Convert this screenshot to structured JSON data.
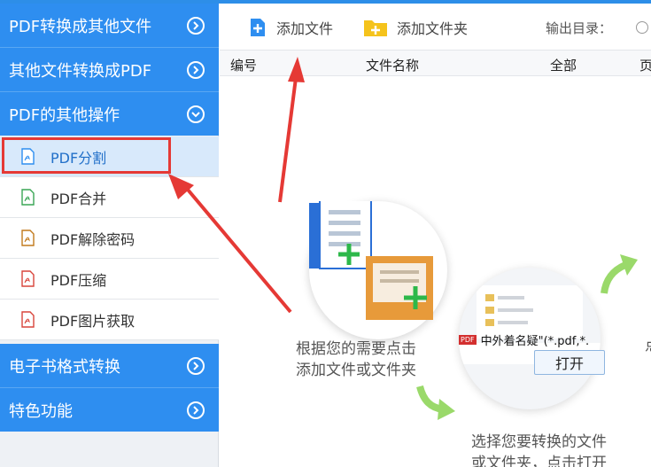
{
  "sidebar": {
    "sections": [
      {
        "label": "PDF转换成其他文件"
      },
      {
        "label": "其他文件转换成PDF"
      },
      {
        "label": "PDF的其他操作"
      },
      {
        "label": "电子书格式转换"
      },
      {
        "label": "特色功能"
      }
    ],
    "sub_items": [
      {
        "label": "PDF分割",
        "icon": "pdf-split-icon",
        "color": "#2e8ef0"
      },
      {
        "label": "PDF合并",
        "icon": "pdf-merge-icon",
        "color": "#3aa655"
      },
      {
        "label": "PDF解除密码",
        "icon": "pdf-unlock-icon",
        "color": "#c27a1d"
      },
      {
        "label": "PDF压缩",
        "icon": "pdf-compress-icon",
        "color": "#d9453b"
      },
      {
        "label": "PDF图片获取",
        "icon": "pdf-image-icon",
        "color": "#d9453b"
      }
    ]
  },
  "toolbar": {
    "add_file": "添加文件",
    "add_folder": "添加文件夹",
    "output_dir_label": "输出目录："
  },
  "table": {
    "headers": [
      "编号",
      "文件名称",
      "全部",
      "页"
    ]
  },
  "guide": {
    "step1_line1": "根据您的需要点击",
    "step1_line2": "添加文件或文件夹",
    "step2_line1": "选择您要转换的文件",
    "step2_line2": "或文件夹，点击打开",
    "dialog_file_name": "中外着名疑\"(*.pdf,*.",
    "dialog_pdf_badge": "PDF",
    "dialog_open": "打开",
    "peek_char": "点"
  },
  "colors": {
    "accent": "#2e8ef0",
    "highlight": "#e53935",
    "arrow": "#e53935",
    "guide_arrow": "#9ad96a"
  }
}
